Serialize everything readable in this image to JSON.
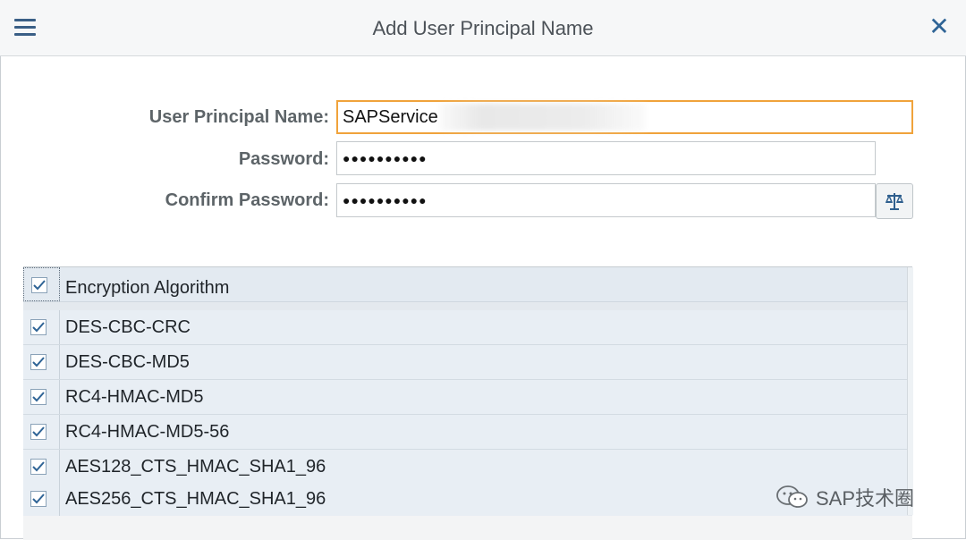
{
  "dialog": {
    "title": "Add User Principal Name",
    "close_icon": "close-icon",
    "menu_icon": "hamburger-menu-icon"
  },
  "form": {
    "upn_label": "User Principal Name:",
    "upn_value": "SAPService",
    "password_label": "Password:",
    "password_value": "●●●●●●●●●●",
    "confirm_label": "Confirm Password:",
    "confirm_value": "●●●●●●●●●●",
    "compare_icon": "balance-scale-icon"
  },
  "table": {
    "header": "Encryption Algorithm",
    "header_checked": true,
    "rows": [
      {
        "label": "DES-CBC-CRC",
        "checked": true
      },
      {
        "label": "DES-CBC-MD5",
        "checked": true
      },
      {
        "label": "RC4-HMAC-MD5",
        "checked": true
      },
      {
        "label": "RC4-HMAC-MD5-56",
        "checked": true
      },
      {
        "label": "AES128_CTS_HMAC_SHA1_96",
        "checked": true
      },
      {
        "label": "AES256_CTS_HMAC_SHA1_96",
        "checked": true
      }
    ]
  },
  "watermark": {
    "text": "SAP技术圈",
    "icon": "wechat-icon"
  },
  "colors": {
    "accent": "#f0a33b",
    "link": "#2f6496",
    "table_bg": "#e8eef4"
  }
}
